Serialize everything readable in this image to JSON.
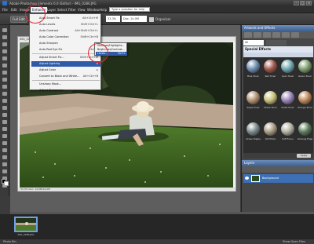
{
  "window": {
    "title": "Adobe Photoshop Elements 6.0 (Editor) - IMG_0286.JPG",
    "controls": [
      "–",
      "□",
      "×"
    ]
  },
  "menubar": {
    "items": [
      "File",
      "Edit",
      "Image",
      "Enhance",
      "Layer",
      "Select",
      "Filter",
      "View",
      "Window",
      "Help"
    ],
    "open_item": "Enhance",
    "help_placeholder": "Type a question for help"
  },
  "options": {
    "full_edit": "Full Edit",
    "zoom": "33.3%",
    "doc_size": "Doc: 14.0M",
    "organizer": "Organizer"
  },
  "document": {
    "tab_title": "IMG_0286.JPG @ 33.3% (RGB/8)",
    "status": "33.3%   Doc: 14.0M/14.0M"
  },
  "enhance_menu": {
    "items": [
      {
        "label": "Auto Smart Fix",
        "shortcut": "Alt+Ctrl+M"
      },
      {
        "label": "Auto Levels",
        "shortcut": "Shift+Ctrl+L"
      },
      {
        "label": "Auto Contrast",
        "shortcut": "Alt+Shift+Ctrl+L"
      },
      {
        "label": "Auto Color Correction",
        "shortcut": "Shift+Ctrl+B"
      },
      {
        "label": "Auto Sharpen",
        "shortcut": ""
      },
      {
        "label": "Auto Red Eye Fix",
        "shortcut": "Ctrl+R"
      },
      {
        "label": "Adjust Smart Fix...",
        "shortcut": "Shift+Ctrl+M"
      },
      {
        "label": "Adjust Lighting",
        "shortcut": "▸"
      },
      {
        "label": "Adjust Color",
        "shortcut": "▸"
      },
      {
        "label": "Convert to Black and White...",
        "shortcut": "Alt+Ctrl+B"
      },
      {
        "label": "Unsharp Mask...",
        "shortcut": ""
      },
      {
        "label": "Adjust Sharpness...",
        "shortcut": ""
      }
    ],
    "highlighted_index": 7
  },
  "lighting_submenu": {
    "items": [
      {
        "label": "Shadows/Highlights...",
        "shortcut": ""
      },
      {
        "label": "Brightness/Contrast...",
        "shortcut": ""
      },
      {
        "label": "Levels...",
        "shortcut": "Ctrl+L"
      }
    ],
    "highlighted_index": 2
  },
  "palette": {
    "header": "Artwork and Effects",
    "dropdown": "All",
    "category": "Special Effects",
    "thumbnails": [
      {
        "label": "Blue Toner",
        "color": "#6d8fb3"
      },
      {
        "label": "Red Toner",
        "color": "#a05a4e"
      },
      {
        "label": "Cyan Toner",
        "color": "#6fa7b0"
      },
      {
        "label": "Green Toner",
        "color": "#7fa070"
      },
      {
        "label": "Sepia Toner",
        "color": "#b09070"
      },
      {
        "label": "Yellow Toner",
        "color": "#c8c07a"
      },
      {
        "label": "Violet Toner",
        "color": "#9a84b8"
      },
      {
        "label": "Orange Toner",
        "color": "#c0895a"
      },
      {
        "label": "Ocean Ripple",
        "color": "#7a8a8a"
      },
      {
        "label": "Old Photo",
        "color": "#a89a82"
      },
      {
        "label": "Soft Focus",
        "color": "#b0b0a0"
      },
      {
        "label": "Glowing Edges",
        "color": "#5c7c5c"
      }
    ],
    "apply_label": "Apply"
  },
  "layers": {
    "header": "Layers",
    "layer_name": "Background"
  },
  "photo_bin": {
    "thumb_label": "IMG_0286.JPG"
  },
  "statusbar": {
    "left": "Photo Bin",
    "right": "Show Open Files"
  }
}
